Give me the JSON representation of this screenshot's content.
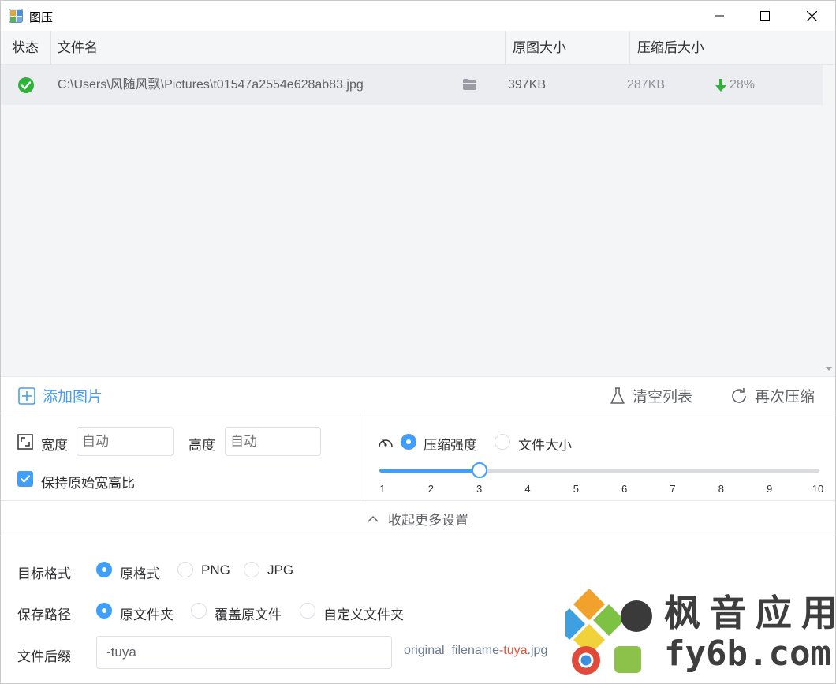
{
  "window": {
    "title": "图压"
  },
  "table": {
    "columns": {
      "status": "状态",
      "filename": "文件名",
      "original_size": "原图大小",
      "compressed_size": "压缩后大小"
    },
    "rows": [
      {
        "status": "success",
        "filename": "C:\\Users\\风随风飘\\Pictures\\t01547a2554e628ab83.jpg",
        "original_size": "397KB",
        "compressed_size": "287KB",
        "reduction": "28%"
      }
    ]
  },
  "actions": {
    "add": "添加图片",
    "clear": "清空列表",
    "recompress": "再次压缩"
  },
  "resize": {
    "width_label": "宽度",
    "width_placeholder": "自动",
    "height_label": "高度",
    "height_placeholder": "自动",
    "keep_ratio_label": "保持原始宽高比",
    "keep_ratio_checked": true
  },
  "compression": {
    "mode_strength_label": "压缩强度",
    "mode_size_label": "文件大小",
    "selected_mode": "strength",
    "level": 3,
    "level_min": 1,
    "level_max": 10,
    "ticks": [
      "1",
      "2",
      "3",
      "4",
      "5",
      "6",
      "7",
      "8",
      "9",
      "10"
    ]
  },
  "collapse_label": "收起更多设置",
  "target_format": {
    "label": "目标格式",
    "options": [
      "原格式",
      "PNG",
      "JPG"
    ],
    "selected": 0
  },
  "save_path": {
    "label": "保存路径",
    "options": [
      "原文件夹",
      "覆盖原文件",
      "自定义文件夹"
    ],
    "selected": 0
  },
  "suffix": {
    "label": "文件后缀",
    "value": "-tuya",
    "preview_prefix": "original_filename",
    "preview_suffix": "-tuya",
    "preview_ext": ".jpg"
  },
  "watermark": {
    "line1": "枫音应用",
    "line2": "fy6b.com"
  },
  "colors": {
    "accent": "#409eff",
    "success": "#2fb33a",
    "suffix_highlight": "#e0503a"
  }
}
